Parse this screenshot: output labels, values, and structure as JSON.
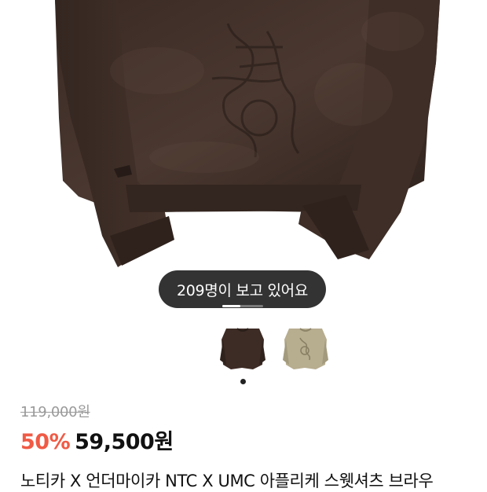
{
  "viewers": {
    "text": "209명이 보고 있어요"
  },
  "gallery": {
    "main_image_icon": "brown-sweatshirt-photo",
    "thumbnails": [
      {
        "icon": "brown-sweatshirt-thumbnail",
        "color": "#3d2b25",
        "selected": true
      },
      {
        "icon": "beige-sweatshirt-thumbnail",
        "color": "#b7ad8f",
        "selected": false
      }
    ],
    "pager_progress": 0.45
  },
  "price": {
    "original": "119,000원",
    "discount": "50%",
    "sale": "59,500원"
  },
  "product": {
    "title": "노티카 X 언더마이카 NTC X UMC 아플리케 스웻셔츠 브라우"
  },
  "colors": {
    "discount": "#f05a45",
    "pill_bg": "#222222",
    "sweatshirt": "#3d2b25"
  }
}
